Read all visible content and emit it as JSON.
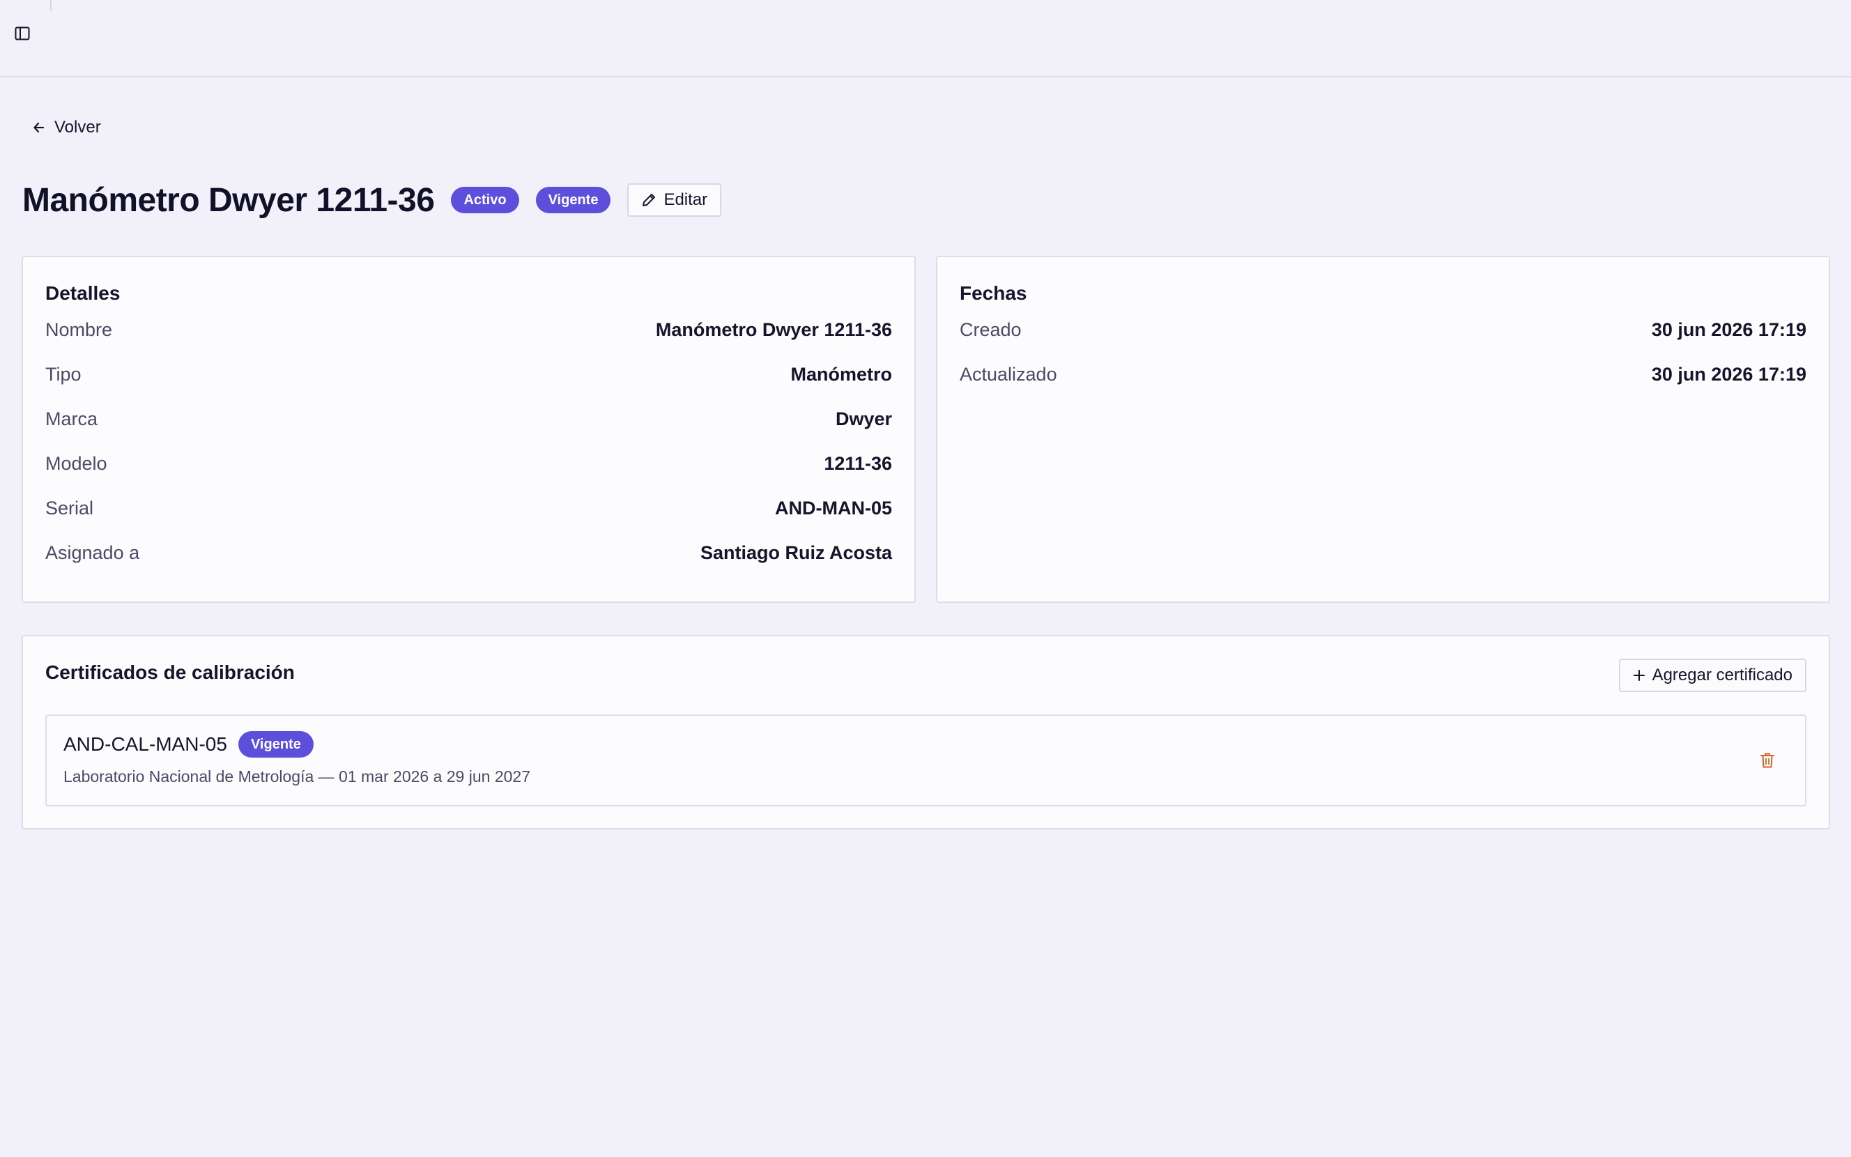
{
  "header": {
    "sidebar_toggle_icon": "sidebar-panel-icon"
  },
  "nav": {
    "back_label": "Volver",
    "back_icon": "arrow-left-icon"
  },
  "page": {
    "title": "Manómetro Dwyer 1211-36",
    "status_badge": "Activo",
    "validity_badge": "Vigente",
    "edit_label": "Editar",
    "edit_icon": "pencil-icon"
  },
  "details": {
    "title": "Detalles",
    "rows": [
      {
        "label": "Nombre",
        "value": "Manómetro Dwyer 1211-36"
      },
      {
        "label": "Tipo",
        "value": "Manómetro"
      },
      {
        "label": "Marca",
        "value": "Dwyer"
      },
      {
        "label": "Modelo",
        "value": "1211-36"
      },
      {
        "label": "Serial",
        "value": "AND-MAN-05"
      },
      {
        "label": "Asignado a",
        "value": "Santiago Ruiz Acosta"
      }
    ]
  },
  "dates": {
    "title": "Fechas",
    "rows": [
      {
        "label": "Creado",
        "value": "30 jun 2026 17:19"
      },
      {
        "label": "Actualizado",
        "value": "30 jun 2026 17:19"
      }
    ]
  },
  "certificates": {
    "title": "Certificados de calibración",
    "add_label": "Agregar certificado",
    "items": [
      {
        "code": "AND-CAL-MAN-05",
        "badge": "Vigente",
        "description": "Laboratorio Nacional de Metrología — 01 mar 2026 a 29 jun 2027"
      }
    ]
  },
  "colors": {
    "accent": "#5b4fdb",
    "background": "#f2f0f9",
    "danger": "#d9622b"
  }
}
